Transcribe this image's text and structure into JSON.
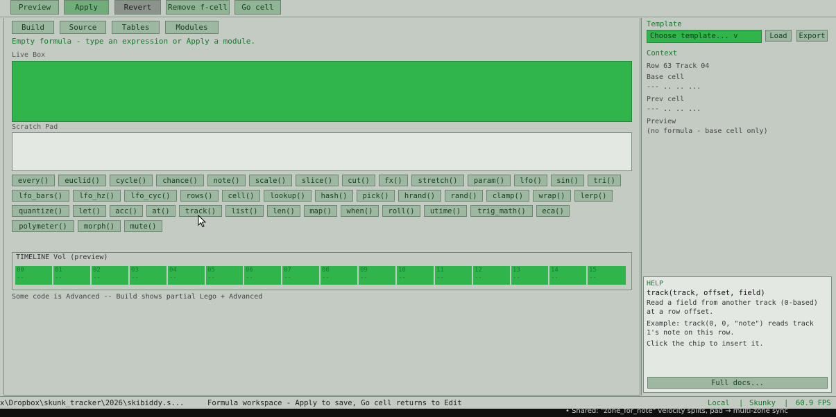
{
  "toolbar": {
    "preview": "Preview",
    "apply": "Apply",
    "revert": "Revert",
    "remove_fcell": "Remove f-cell",
    "go_cell": "Go cell"
  },
  "tabs": {
    "build": "Build",
    "source": "Source",
    "tables": "Tables",
    "modules": "Modules"
  },
  "hint": "Empty formula - type an expression or Apply a module.",
  "live_box_label": "Live Box",
  "scratch_pad_label": "Scratch Pad",
  "chips": [
    "every()",
    "euclid()",
    "cycle()",
    "chance()",
    "note()",
    "scale()",
    "slice()",
    "cut()",
    "fx()",
    "stretch()",
    "param()",
    "lfo()",
    "sin()",
    "tri()",
    "lfo_bars()",
    "lfo_hz()",
    "lfo_cyc()",
    "rows()",
    "cell()",
    "lookup()",
    "hash()",
    "pick()",
    "hrand()",
    "rand()",
    "clamp()",
    "wrap()",
    "lerp()",
    "quantize()",
    "let()",
    "acc()",
    "at()",
    "track()",
    "list()",
    "len()",
    "map()",
    "when()",
    "roll()",
    "utime()",
    "trig_math()",
    "eca()",
    "polymeter()",
    "morph()",
    "mute()"
  ],
  "timeline": {
    "title": "TIMELINE  Vol  (preview)",
    "cells": [
      {
        "n": "00",
        "v": "--"
      },
      {
        "n": "01",
        "v": "--"
      },
      {
        "n": "02",
        "v": "--"
      },
      {
        "n": "03",
        "v": "--"
      },
      {
        "n": "04",
        "v": "--"
      },
      {
        "n": "05",
        "v": "--"
      },
      {
        "n": "06",
        "v": "--"
      },
      {
        "n": "07",
        "v": "--"
      },
      {
        "n": "08",
        "v": "--"
      },
      {
        "n": "09",
        "v": "--"
      },
      {
        "n": "10",
        "v": "--"
      },
      {
        "n": "11",
        "v": "--"
      },
      {
        "n": "12",
        "v": "--"
      },
      {
        "n": "13",
        "v": "--"
      },
      {
        "n": "14",
        "v": "--"
      },
      {
        "n": "15",
        "v": "--"
      }
    ]
  },
  "code_note": "Some code is Advanced -- Build shows partial Lego + Advanced",
  "right": {
    "template_label": "Template",
    "template_value": "Choose template...  v",
    "load": "Load",
    "export": "Export",
    "context_label": "Context",
    "row_track": "Row 63  Track 04",
    "base_cell_label": "Base cell",
    "base_cell_value": "--- .. .. ...",
    "prev_cell_label": "Prev cell",
    "prev_cell_value": "--- .. .. ...",
    "preview_label": "Preview",
    "preview_value": "(no formula - base cell only)"
  },
  "help": {
    "title": "HELP",
    "signature": "track(track, offset, field)",
    "desc": "Read a field from another track (0-based) at a row offset.",
    "example": "Example: track(0, 0, \"note\") reads track 1's note on this row.",
    "tip": "Click the chip to insert it.",
    "full_docs": "Full docs..."
  },
  "status": {
    "path": "x\\Dropbox\\skunk_tracker\\2026\\skibiddy.s...",
    "message": "Formula workspace - Apply to save, Go cell returns to Edit",
    "mode": "Local",
    "sep1": "|",
    "user": "Skunky",
    "sep2": "|",
    "fps": "60.9 FPS"
  },
  "taskbar_text": "•   Shared: \"zone_for_note\" velocity splits, pad → multi-zone sync"
}
